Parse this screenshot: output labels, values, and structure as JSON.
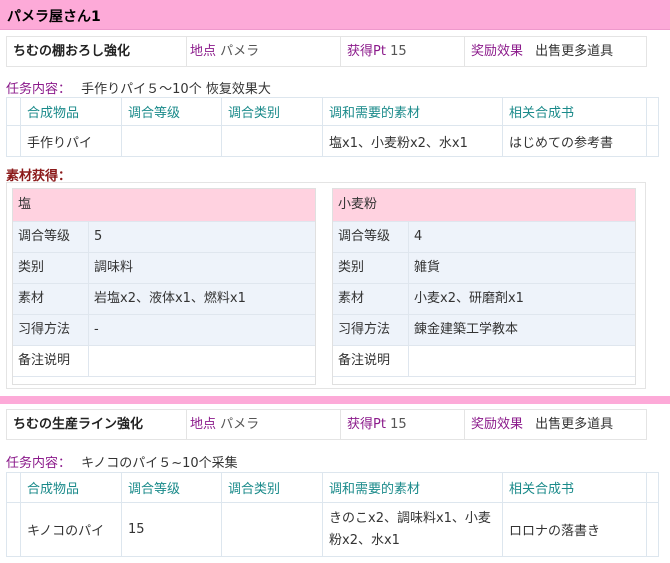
{
  "page": {
    "title": "パメラ屋さん1"
  },
  "quests": [
    {
      "name": "ちむの棚おろし強化",
      "location_label": "地点",
      "location": "パメラ",
      "points_label": "获得Pt",
      "points": "15",
      "reward_label": "奖励效果",
      "reward": "出售更多道具",
      "task_label": "任务内容：",
      "task": "手作りパイ５～10个 恢复效果大",
      "headers": [
        "合成物品",
        "调合等级",
        "调合类别",
        "调和需要的素材",
        "相关合成书"
      ],
      "row": [
        "手作りパイ",
        "",
        "",
        "塩x1、小麦粉x2、水x1",
        "はじめての参考書"
      ]
    },
    {
      "name": "ちむの生産ライン強化",
      "location_label": "地点",
      "location": "パメラ",
      "points_label": "获得Pt",
      "points": "15",
      "reward_label": "奖励效果",
      "reward": "出售更多道具",
      "task_label": "任务内容：",
      "task": "キノコのパイ５~10个采集",
      "headers": [
        "合成物品",
        "调合等级",
        "调合类别",
        "调和需要的素材",
        "相关合成书"
      ],
      "row": [
        "キノコのパイ",
        "15",
        "",
        "きのこx2、調味料x1、小麦粉x2、水x1",
        "ロロナの落書き"
      ]
    }
  ],
  "materials_label": "素材获得：",
  "materials": [
    {
      "name": "塩",
      "rows": [
        {
          "k": "调合等级",
          "v": "5"
        },
        {
          "k": "类别",
          "v": "調味料"
        },
        {
          "k": "素材",
          "v": "岩塩x2、液体x1、燃料x1"
        },
        {
          "k": "习得方法",
          "v": "-"
        },
        {
          "k": "备注说明",
          "v": ""
        }
      ]
    },
    {
      "name": "小麦粉",
      "rows": [
        {
          "k": "调合等级",
          "v": "4"
        },
        {
          "k": "类别",
          "v": "雑貨"
        },
        {
          "k": "素材",
          "v": "小麦x2、研磨剤x1"
        },
        {
          "k": "习得方法",
          "v": "錬金建築工学教本"
        },
        {
          "k": "备注说明",
          "v": ""
        }
      ]
    }
  ],
  "colors": {
    "title_bg": "#fdaad8",
    "card_head": "#ffd2e0",
    "header_text": "#1a8a8a",
    "label_purple": "#8b1a8b"
  }
}
